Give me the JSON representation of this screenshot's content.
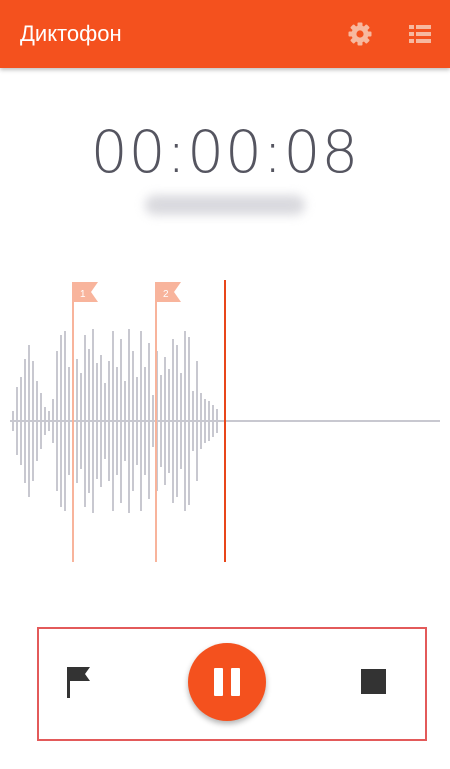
{
  "app": {
    "title": "Диктофон"
  },
  "icons": {
    "settings": "gear-icon",
    "recordings_list": "list-icon",
    "add_marker": "flag-icon",
    "pause": "pause-icon",
    "stop": "stop-icon"
  },
  "recorder": {
    "elapsed_time": "00:00:08",
    "markers": [
      {
        "label": "1"
      },
      {
        "label": "2"
      }
    ]
  },
  "colors": {
    "accent": "#f4511e",
    "marker": "#f8b49c",
    "waveform": "#c8c8d0",
    "playhead": "#e8461a",
    "control_dark": "#333333"
  }
}
